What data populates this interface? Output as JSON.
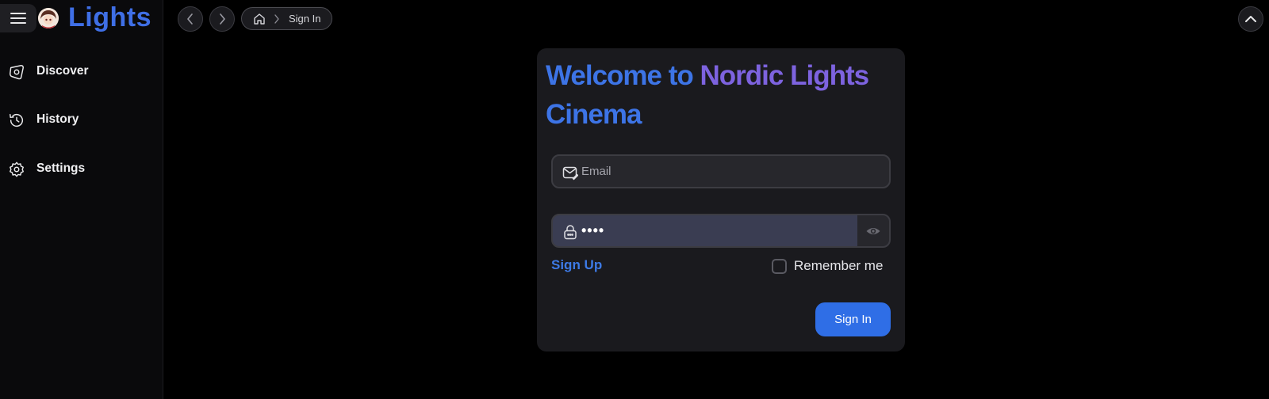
{
  "app": {
    "brand": "Lights"
  },
  "sidebar": {
    "items": [
      {
        "label": "Discover",
        "icon": "compass-icon"
      },
      {
        "label": "History",
        "icon": "history-clock-icon"
      },
      {
        "label": "Settings",
        "icon": "gear-icon"
      }
    ]
  },
  "topbar": {
    "breadcrumb": {
      "home_icon": "home-icon",
      "current": "Sign In"
    }
  },
  "signin": {
    "title_line1_a": "Welcome to ",
    "title_line1_b": "Nordic Lights",
    "title_line2": "Cinema",
    "email_placeholder": "Email",
    "email_value": "",
    "password_value": "••••",
    "signup_link": "Sign Up",
    "remember_label": "Remember me",
    "remember_checked": false,
    "submit_label": "Sign In"
  },
  "colors": {
    "accent": "#2f6ee6",
    "brand_blue": "#3f6fe6",
    "brand_purple": "#7d63df",
    "background": "#000000",
    "card": "#1a1a1e"
  }
}
